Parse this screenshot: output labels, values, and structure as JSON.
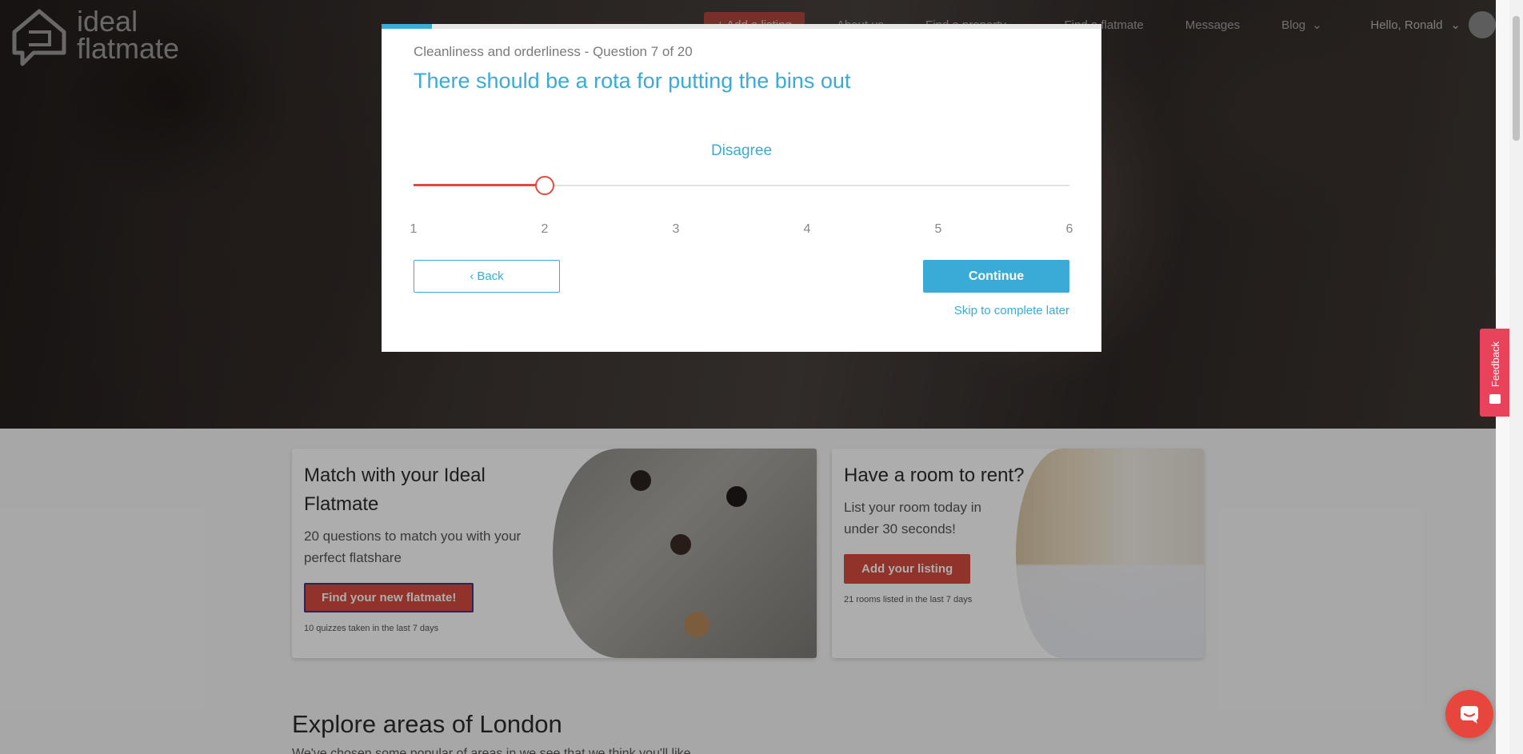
{
  "logo": {
    "line1": "ideal",
    "line2": "flatmate"
  },
  "nav": {
    "add_listing": "+ Add a listing",
    "about": "About us",
    "find_property": "Find a property",
    "find_flatmate": "Find a flatmate",
    "messages": "Messages",
    "blog": "Blog",
    "greeting": "Hello, Ronald"
  },
  "quiz": {
    "category": "Cleanliness and orderliness",
    "question_counter": "- Question 7 of 20",
    "question": "There should be a rota for putting the bins out",
    "answer_label": "Disagree",
    "slider_min": 1,
    "slider_max": 6,
    "slider_value": 2,
    "progress_fraction": 0.07,
    "ticks": [
      "1",
      "2",
      "3",
      "4",
      "5",
      "6"
    ],
    "back_label": "Back",
    "continue_label": "Continue",
    "skip_label": "Skip to complete later"
  },
  "cards": [
    {
      "title": "Match with your Ideal Flatmate",
      "subtitle": "20 questions to match you with your perfect flatshare",
      "button": "Find your new flatmate!",
      "note": "10 quizzes taken in the last 7 days"
    },
    {
      "title": "Have a room to rent?",
      "subtitle": "List your room today in under 30 seconds!",
      "button": "Add your listing",
      "note": "21 rooms listed in the last 7 days"
    }
  ],
  "explore": {
    "title": "Explore areas of London",
    "subtitle": "We've chosen some popular of areas in we see that we think you'll like"
  },
  "feedback": {
    "label": "Feedback"
  },
  "colors": {
    "accent": "#3aabd6",
    "brand_red": "#d64a40",
    "slider_red": "#e04a40",
    "feedback": "#e8435a"
  },
  "icons": [
    "logo-house-icon",
    "chevron-down-icon",
    "chevron-left-icon",
    "feedback-icon",
    "chat-icon"
  ]
}
